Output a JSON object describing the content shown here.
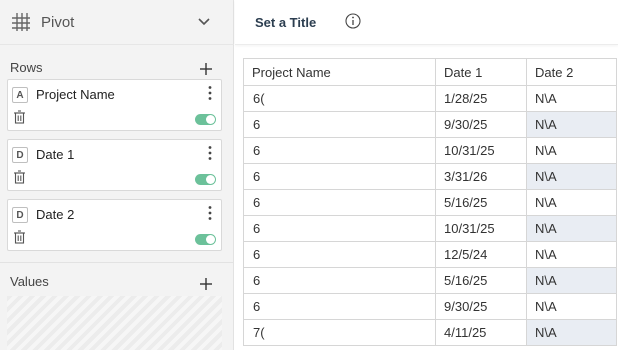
{
  "pivot": {
    "title": "Pivot"
  },
  "rows_section": {
    "label": "Rows",
    "fields": [
      {
        "type": "A",
        "name": "Project Name"
      },
      {
        "type": "D",
        "name": "Date 1"
      },
      {
        "type": "D",
        "name": "Date 2"
      }
    ]
  },
  "values_section": {
    "label": "Values"
  },
  "header": {
    "set_title": "Set a Title"
  },
  "table": {
    "columns": [
      "Project Name",
      "Date 1",
      "Date 2"
    ],
    "rows": [
      {
        "name": "6(",
        "d1": "1/28/25",
        "d2": "N\\A"
      },
      {
        "name": "6",
        "d1": "9/30/25",
        "d2": "N\\A"
      },
      {
        "name": "6",
        "d1": "10/31/25",
        "d2": "N\\A"
      },
      {
        "name": "6",
        "d1": "3/31/26",
        "d2": "N\\A"
      },
      {
        "name": "6",
        "d1": "5/16/25",
        "d2": "N\\A"
      },
      {
        "name": "6",
        "d1": "10/31/25",
        "d2": "N\\A"
      },
      {
        "name": "6",
        "d1": "12/5/24",
        "d2": "N\\A"
      },
      {
        "name": "6",
        "d1": "5/16/25",
        "d2": "N\\A"
      },
      {
        "name": "6",
        "d1": "9/30/25",
        "d2": "N\\A"
      },
      {
        "name": "7(",
        "d1": "4/11/25",
        "d2": "N\\A"
      }
    ]
  },
  "colors": {
    "toggle_on": "#6cc19a",
    "alt_row": "#e9edf3",
    "title_text": "#2c3e50"
  }
}
